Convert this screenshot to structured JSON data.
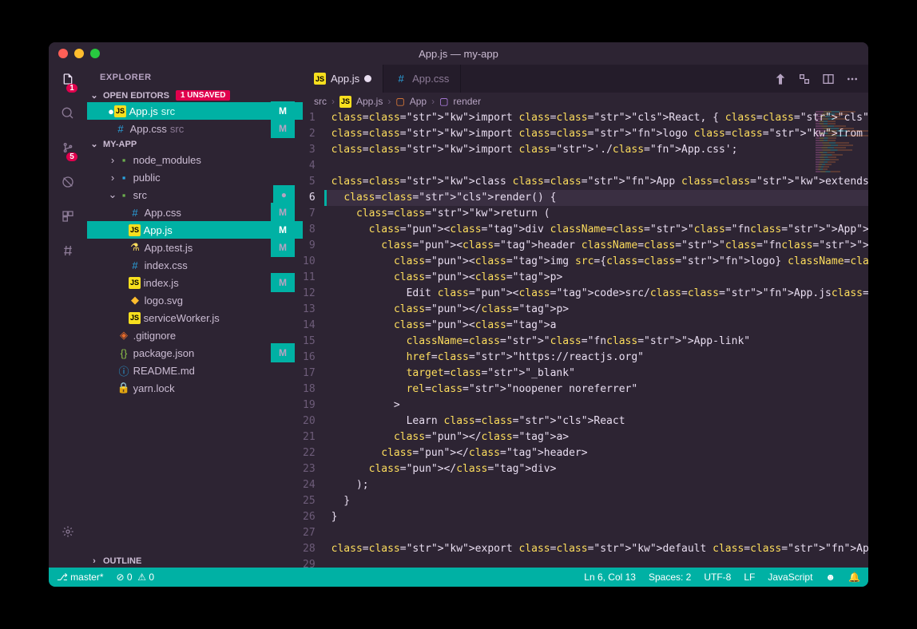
{
  "window": {
    "title": "App.js — my-app"
  },
  "activity": {
    "files_badge": "1",
    "scm_badge": "5"
  },
  "sidebar": {
    "title": "EXPLORER",
    "openEditors": {
      "label": "OPEN EDITORS",
      "unsaved": "1 UNSAVED",
      "items": [
        {
          "name": "App.js",
          "dir": "src",
          "status": "M",
          "iconKind": "js",
          "modified": true,
          "active": true
        },
        {
          "name": "App.css",
          "dir": "src",
          "status": "M",
          "iconKind": "css",
          "modified": false,
          "active": false
        }
      ]
    },
    "project": {
      "label": "MY-APP",
      "tree": [
        {
          "name": "node_modules",
          "indent": 1,
          "icon": "folder-green",
          "chev": "›"
        },
        {
          "name": "public",
          "indent": 1,
          "icon": "folder-blue",
          "chev": "›"
        },
        {
          "name": "src",
          "indent": 1,
          "icon": "folder-green",
          "chev": "⌄",
          "status": "●"
        },
        {
          "name": "App.css",
          "indent": 2,
          "icon": "css",
          "status": "M"
        },
        {
          "name": "App.js",
          "indent": 2,
          "icon": "js",
          "status": "M",
          "active": true
        },
        {
          "name": "App.test.js",
          "indent": 2,
          "icon": "test",
          "status": "M"
        },
        {
          "name": "index.css",
          "indent": 2,
          "icon": "css"
        },
        {
          "name": "index.js",
          "indent": 2,
          "icon": "js",
          "status": "M"
        },
        {
          "name": "logo.svg",
          "indent": 2,
          "icon": "svg"
        },
        {
          "name": "serviceWorker.js",
          "indent": 2,
          "icon": "js"
        },
        {
          "name": ".gitignore",
          "indent": 1,
          "icon": "git"
        },
        {
          "name": "package.json",
          "indent": 1,
          "icon": "json",
          "status": "M"
        },
        {
          "name": "README.md",
          "indent": 1,
          "icon": "info"
        },
        {
          "name": "yarn.lock",
          "indent": 1,
          "icon": "lock"
        }
      ]
    },
    "outline": "OUTLINE"
  },
  "tabs": [
    {
      "name": "App.js",
      "iconKind": "js",
      "modified": true,
      "active": true
    },
    {
      "name": "App.css",
      "iconKind": "css",
      "modified": false,
      "active": false
    }
  ],
  "breadcrumbs": [
    "src",
    "App.js",
    "App",
    "render"
  ],
  "code": {
    "currentLine": 6,
    "modifiedLines": [
      5,
      13
    ],
    "lines": [
      "import React, { Component } from 'react';",
      "import logo from './logo.svg';",
      "import './App.css';",
      "",
      "class App extends Component {",
      "  render() {",
      "    return (",
      "      <div className=\"App\">",
      "        <header className=\"App-header\">",
      "          <img src={logo} className=\"App-logo\" alt=\"logo\" />",
      "          <p>",
      "            Edit <code>src/App.js</code> and save to reload.",
      "          </p>",
      "          <a",
      "            className=\"App-link\"",
      "            href=\"https://reactjs.org\"",
      "            target=\"_blank\"",
      "            rel=\"noopener noreferrer\"",
      "          >",
      "            Learn React",
      "          </a>",
      "        </header>",
      "      </div>",
      "    );",
      "  }",
      "}",
      "",
      "export default App;",
      ""
    ]
  },
  "statusbar": {
    "branch": "master*",
    "errors": "0",
    "warnings": "0",
    "cursor": "Ln 6, Col 13",
    "spaces": "Spaces: 2",
    "encoding": "UTF-8",
    "eol": "LF",
    "lang": "JavaScript"
  }
}
